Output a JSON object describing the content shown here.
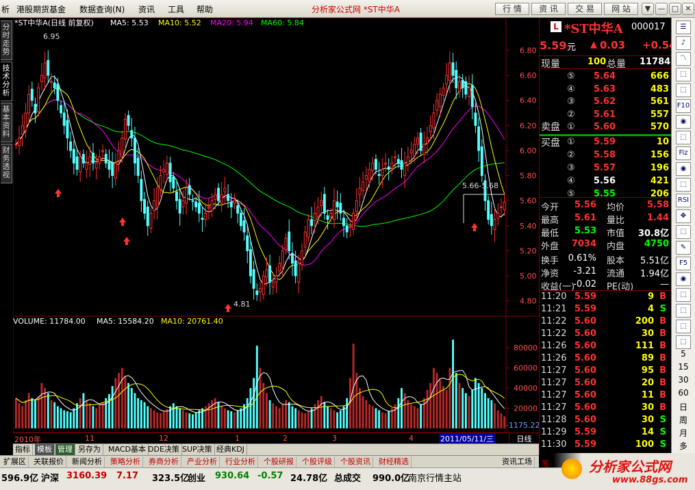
{
  "menu": {
    "items": [
      "析",
      "港股期货基金",
      "数据查询(N)",
      "资讯",
      "工具",
      "帮助"
    ],
    "title": "分析家公式网 *ST中华A",
    "buttons": [
      "行 情",
      "资 讯",
      "交 易",
      "网 站"
    ],
    "win": [
      "▼",
      "—",
      "□",
      "✕"
    ]
  },
  "left_tabs": [
    "分时走势",
    "技术分析",
    "基本资料",
    "财务透视"
  ],
  "chart": {
    "header": {
      "name": "*ST中华A(日线 前复权)",
      "ma5": "MA5: 5.53",
      "ma10": "MA10: 5.52",
      "ma20": "MA20: 5.94",
      "ma60": "MA60: 5.84"
    },
    "price_ticks": [
      "6.80",
      "6.60",
      "6.40",
      "6.20",
      "6.00",
      "5.80",
      "5.60",
      "5.40",
      "5.20",
      "5.00",
      "4.80"
    ],
    "high_label": "6.95",
    "low_label": "4.81",
    "cursor_label": "5.66-5.68",
    "vol_header": {
      "vol": "VOLUME: 11784.00",
      "ma5": "MA5: 15584.20",
      "ma10": "MA10: 20761.40"
    },
    "vol_ticks": [
      "80000",
      "60000",
      "40000",
      "20000"
    ],
    "vol_right": "-1175.22",
    "date_labels": [
      "2010年",
      "11",
      "12",
      "1",
      "2",
      "3",
      "4"
    ],
    "date_box": "2011/05/11/三",
    "period": "日线",
    "colors": {
      "up": "#ff3232",
      "down": "#54ffff",
      "ma5": "#ffffff",
      "ma10": "#ffff00",
      "ma20": "#ff00ff",
      "ma60": "#00ff00",
      "grid": "#800000"
    }
  },
  "chart_data": {
    "type": "candlestick",
    "title": "*ST中华A(日线 前复权)",
    "ylim": [
      4.7,
      6.95
    ],
    "high": 6.95,
    "low": 4.81,
    "closes": [
      6.05,
      6.1,
      6.2,
      6.3,
      6.45,
      6.4,
      6.3,
      6.5,
      6.6,
      6.7,
      6.6,
      6.55,
      6.5,
      6.4,
      6.3,
      6.2,
      6.1,
      6.0,
      5.9,
      5.85,
      5.95,
      5.9,
      5.9,
      5.95,
      5.9,
      5.9,
      5.95,
      6.0,
      5.9,
      5.85,
      5.8,
      5.9,
      6.0,
      6.1,
      6.25,
      6.2,
      6.1,
      5.9,
      5.8,
      5.6,
      5.5,
      5.4,
      5.5,
      5.6,
      5.7,
      5.8,
      5.85,
      5.9,
      5.75,
      5.7,
      5.6,
      5.5,
      5.6,
      5.7,
      5.65,
      5.6,
      5.55,
      5.5,
      5.45,
      5.5,
      5.55,
      5.6,
      5.65,
      5.6,
      5.65,
      5.7,
      5.6,
      5.55,
      5.6,
      5.5,
      5.4,
      5.35,
      5.2,
      5.0,
      4.9,
      4.85,
      4.9,
      5.0,
      5.05,
      4.95,
      4.95,
      5.0,
      5.1,
      5.2,
      5.3,
      5.2,
      5.1,
      5.0,
      5.1,
      5.2,
      5.35,
      5.45,
      5.4,
      5.5,
      5.55,
      5.6,
      5.5,
      5.45,
      5.5,
      5.6,
      5.55,
      5.5,
      5.4,
      5.35,
      5.4,
      5.5,
      5.6,
      5.7,
      5.75,
      5.8,
      5.85,
      5.9,
      5.85,
      5.8,
      5.85,
      5.9,
      5.85,
      5.9,
      5.95,
      5.9,
      5.85,
      5.9,
      5.95,
      6.0,
      6.05,
      6.1,
      6.0,
      6.05,
      6.1,
      6.2,
      6.3,
      6.4,
      6.45,
      6.5,
      6.6,
      6.7,
      6.6,
      6.5,
      6.55,
      6.5,
      6.45,
      6.5,
      6.35,
      6.2,
      6.0,
      5.8,
      5.6,
      5.45,
      5.4,
      5.45,
      5.5,
      5.55,
      5.59
    ],
    "volumes": [
      30000,
      25000,
      22000,
      28000,
      35000,
      30000,
      28000,
      32000,
      45000,
      40000,
      35000,
      28000,
      26000,
      22000,
      20000,
      18000,
      17000,
      16000,
      20000,
      25000,
      30000,
      35000,
      28000,
      25000,
      22000,
      20000,
      24000,
      26000,
      30000,
      34000,
      42000,
      50000,
      55000,
      60000,
      52000,
      45000,
      40000,
      35000,
      30000,
      28000,
      26000,
      22000,
      20000,
      18000,
      16000,
      15000,
      17000,
      19000,
      22000,
      25000,
      22000,
      20000,
      18000,
      16000,
      15000,
      14000,
      16000,
      18000,
      20000,
      22000,
      25000,
      28000,
      30000,
      26000,
      22000,
      20000,
      18000,
      17000,
      16000,
      18000,
      20000,
      24000,
      30000,
      40000,
      50000,
      82000,
      60000,
      45000,
      35000,
      28000,
      25000,
      22000,
      20000,
      24000,
      28000,
      26000,
      22000,
      20000,
      18000,
      16000,
      15000,
      17000,
      20000,
      24000,
      28000,
      32000,
      26000,
      22000,
      20000,
      18000,
      16000,
      18000,
      22000,
      30000,
      50000,
      84000,
      55000,
      40000,
      32000,
      28000,
      24000,
      22000,
      20000,
      18000,
      16000,
      15000,
      17000,
      20000,
      24000,
      30000,
      40000,
      35000,
      28000,
      24000,
      22000,
      20000,
      24000,
      30000,
      38000,
      45000,
      60000,
      55000,
      48000,
      42000,
      38000,
      60000,
      88000,
      55000,
      45000,
      40000,
      35000,
      32000,
      38000,
      50000,
      45000,
      40000,
      35000,
      30000,
      28000,
      25000,
      18000,
      15000,
      12000
    ]
  },
  "quote": {
    "badge": "L",
    "name": "*ST中华A",
    "code": "000017",
    "price": "5.59",
    "unit": "元",
    "arrow": "▲",
    "change": "0.03",
    "change2": "+0.54",
    "xianliang_label": "现量",
    "xianliang": "100",
    "zongliang_label": "总量",
    "zongliang": "11784",
    "sell_label": "卖盘",
    "buy_label": "买盘",
    "asks": [
      {
        "n": "⑤",
        "p": "5.64",
        "v": "666"
      },
      {
        "n": "④",
        "p": "5.63",
        "v": "483"
      },
      {
        "n": "③",
        "p": "5.62",
        "v": "561"
      },
      {
        "n": "②",
        "p": "5.61",
        "v": "557"
      },
      {
        "n": "①",
        "p": "5.60",
        "v": "570"
      }
    ],
    "bids": [
      {
        "n": "①",
        "p": "5.59",
        "v": "10"
      },
      {
        "n": "②",
        "p": "5.58",
        "v": "156"
      },
      {
        "n": "③",
        "p": "5.57",
        "v": "196"
      },
      {
        "n": "④",
        "p": "5.56",
        "v": "421"
      },
      {
        "n": "⑤",
        "p": "5.55",
        "v": "206"
      }
    ],
    "stats": [
      [
        "今开",
        "5.56",
        "均价",
        "5.58"
      ],
      [
        "最高",
        "5.61",
        "量比",
        "1.44"
      ],
      [
        "最低",
        "5.53",
        "市值",
        "30.8亿"
      ],
      [
        "外盘",
        "7034",
        "内盘",
        "4750"
      ]
    ],
    "stats2": [
      [
        "换手",
        "0.61%",
        "股本",
        "5.51亿"
      ],
      [
        "净资",
        "-3.21",
        "流通",
        "1.94亿"
      ],
      [
        "收益(一)",
        "-0.02",
        "PE(动)",
        "—"
      ]
    ],
    "ticks": [
      [
        "11:20",
        "5.59",
        "9",
        "B"
      ],
      [
        "11:21",
        "5.59",
        "4",
        "S"
      ],
      [
        "11:22",
        "5.60",
        "200",
        "B"
      ],
      [
        "11:22",
        "5.60",
        "30",
        "B"
      ],
      [
        "11:26",
        "5.60",
        "111",
        "B"
      ],
      [
        "11:26",
        "5.60",
        "89",
        "B"
      ],
      [
        "11:27",
        "5.60",
        "95",
        "B"
      ],
      [
        "11:27",
        "5.60",
        "20",
        "B"
      ],
      [
        "11:27",
        "5.60",
        "11",
        "B"
      ],
      [
        "11:27",
        "5.60",
        "30",
        "B"
      ],
      [
        "11:28",
        "5.60",
        "30",
        "S"
      ],
      [
        "11:29",
        "5.59",
        "14",
        "S"
      ],
      [
        "11:30",
        "5.59",
        "100",
        "S"
      ]
    ]
  },
  "chart_tabs": [
    "指标",
    "模板",
    "管理",
    "另存为",
    "MACD基本",
    "DDE决策",
    "SUP决策",
    "经典KDJ"
  ],
  "func_tabs": [
    "扩展区",
    "关联报价",
    "新闻分析",
    "策略分析",
    "券商分析",
    "产业分析",
    "行业分析",
    "个股研报",
    "个股评级",
    "个股资讯",
    "财经精选",
    "资讯工场",
    "+",
    "-",
    "□"
  ],
  "status": {
    "s1": "596.9亿",
    "s2": "沪深",
    "s3": "3160.39",
    "s4": "7.17",
    "s5": "323.5亿",
    "s6": "创业",
    "s7": "930.64",
    "s8": "-0.57",
    "s9": "24.78亿",
    "s10": "总成交",
    "s11": "990.0亿",
    "s12": "南京行情主站",
    "s13": "笔"
  },
  "right_icons": [
    "☰",
    "♪",
    "〽",
    "⬚",
    "⬚",
    "F10",
    "◉",
    "⬚",
    "Fiz",
    "◉",
    "⬚",
    "RSI",
    "✥",
    "⬚",
    "✎",
    "F5",
    "◉",
    "⬚",
    "⬚",
    "⬚",
    "⬚"
  ],
  "right_labels": [
    "5",
    "15",
    "30",
    "60",
    "日",
    "周",
    "月",
    "多"
  ],
  "logo": {
    "text": "分析家公式网",
    "url": "www.88gs.com"
  }
}
